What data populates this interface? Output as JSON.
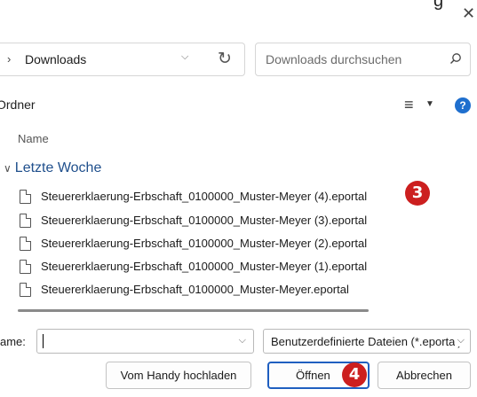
{
  "window": {
    "title_fragment": "g",
    "close_glyph": "✕"
  },
  "address_bar": {
    "chevron": "›",
    "crumb": "Downloads",
    "dropdown_glyph": "⌵",
    "refresh_glyph": "↻"
  },
  "search": {
    "placeholder": "Downloads durchsuchen",
    "icon": "search-icon"
  },
  "toolbar": {
    "organize_label": "Ordner",
    "view_glyph": "≡",
    "view_dropdown_glyph": "▼",
    "help_glyph": "?"
  },
  "list": {
    "column_header": "Name",
    "group": {
      "chevron": "∨",
      "label": "Letzte Woche"
    },
    "files": [
      {
        "name": "Steuererklaerung-Erbschaft_0100000_Muster-Meyer (4).eportal"
      },
      {
        "name": "Steuererklaerung-Erbschaft_0100000_Muster-Meyer (3).eportal"
      },
      {
        "name": "Steuererklaerung-Erbschaft_0100000_Muster-Meyer (2).eportal"
      },
      {
        "name": "Steuererklaerung-Erbschaft_0100000_Muster-Meyer (1).eportal"
      },
      {
        "name": "Steuererklaerung-Erbschaft_0100000_Muster-Meyer.eportal"
      }
    ]
  },
  "annotations": {
    "badge_3": "3",
    "badge_4": "4",
    "color": "#cc1f1f"
  },
  "footer": {
    "filename_label": "ame:",
    "filename_value": "",
    "filename_dropdown_glyph": "⌵",
    "filetype_value": "Benutzerdefinierte Dateien (*.eportal)",
    "filetype_dropdown_glyph": "⌵",
    "upload_button": "Vom Handy hochladen",
    "open_button": "Öffnen",
    "cancel_button": "Abbrechen"
  },
  "colors": {
    "accent": "#1f6fce",
    "group_heading": "#1f4f8c",
    "primary_border": "#1f5fc0"
  }
}
